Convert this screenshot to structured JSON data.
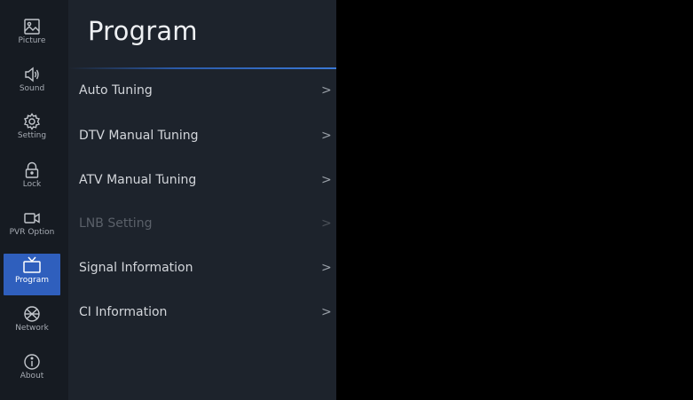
{
  "rail": {
    "items": [
      {
        "label": "Picture",
        "icon": "picture-icon"
      },
      {
        "label": "Sound",
        "icon": "speaker-icon"
      },
      {
        "label": "Setting",
        "icon": "gear-icon"
      },
      {
        "label": "Lock",
        "icon": "lock-icon"
      },
      {
        "label": "PVR Option",
        "icon": "video-camera-icon"
      },
      {
        "label": "Program",
        "icon": "tv-icon",
        "active": true
      },
      {
        "label": "Network",
        "icon": "globe-icon"
      },
      {
        "label": "About",
        "icon": "info-icon"
      }
    ]
  },
  "panel": {
    "title": "Program",
    "items": [
      {
        "label": "Auto Tuning",
        "arrow": ">",
        "enabled": true
      },
      {
        "label": "DTV Manual Tuning",
        "arrow": ">",
        "enabled": true
      },
      {
        "label": "ATV Manual Tuning",
        "arrow": ">",
        "enabled": true
      },
      {
        "label": "LNB Setting",
        "arrow": ">",
        "enabled": false
      },
      {
        "label": "Signal Information",
        "arrow": ">",
        "enabled": true
      },
      {
        "label": "CI Information",
        "arrow": ">",
        "enabled": true
      }
    ]
  },
  "colors": {
    "rail_bg": "#161b22",
    "panel_bg": "#1d232c",
    "active": "#2f5fbd",
    "accent": "#3a78d6"
  }
}
